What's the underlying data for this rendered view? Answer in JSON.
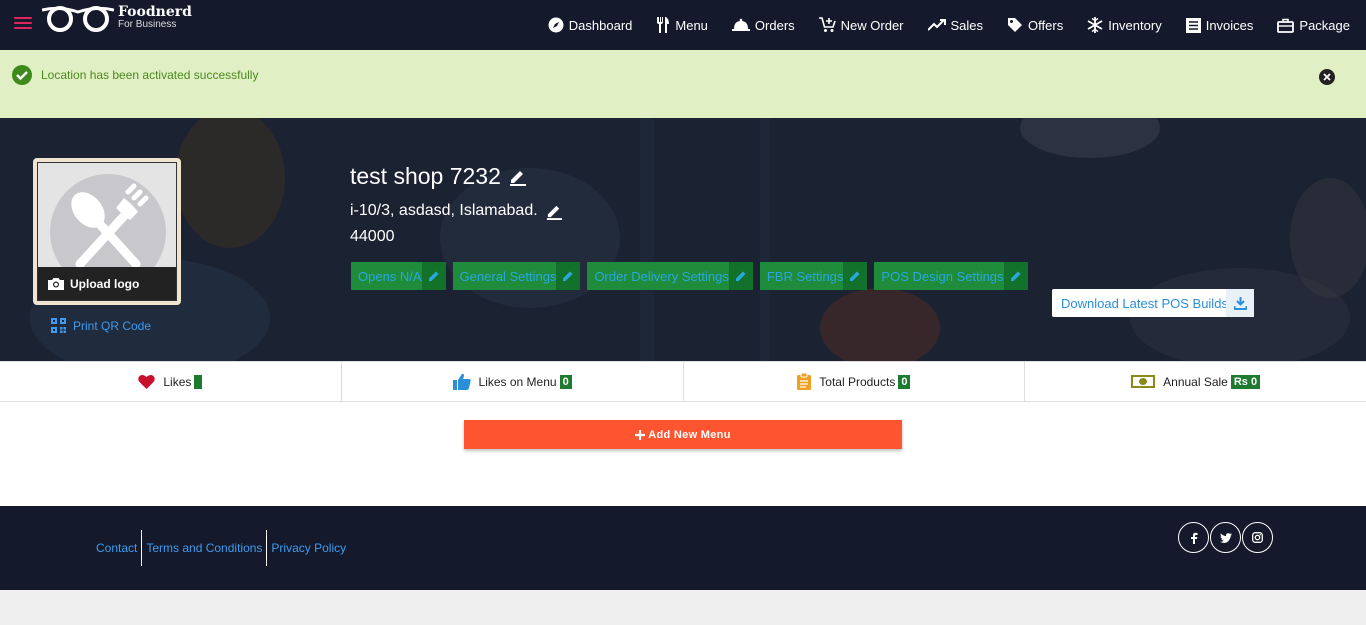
{
  "brand": {
    "name": "Foodnerd",
    "tagline": "For Business"
  },
  "nav": {
    "dashboard": "Dashboard",
    "menu": "Menu",
    "orders": "Orders",
    "new_order": "New Order",
    "sales": "Sales",
    "offers": "Offers",
    "inventory": "Inventory",
    "invoices": "Invoices",
    "package": "Package"
  },
  "alert": {
    "message": "Location has been activated successfully"
  },
  "shop": {
    "name": "test shop 7232",
    "address": "i-10/3, asdasd, Islamabad.",
    "postal_code": "44000",
    "upload_logo": "Upload logo",
    "print_qr": "Print QR Code"
  },
  "settings": {
    "opens": "Opens N/A",
    "general": "General Settings",
    "order_delivery": "Order Delivery Settings",
    "fbr": "FBR Settings",
    "pos_design": "POS Design Settings"
  },
  "pos_download": "Download Latest POS Builds",
  "stats": {
    "likes_label": "Likes",
    "likes_value": "",
    "menu_likes_label": "Likes on Menu",
    "menu_likes_value": "0",
    "products_label": "Total Products",
    "products_value": "0",
    "annual_sale_label": "Annual Sale",
    "annual_sale_value": "Rs 0"
  },
  "add_menu_label": "Add New Menu",
  "footer": {
    "contact": "Contact",
    "terms": "Terms and Conditions",
    "privacy": "Privacy Policy"
  },
  "colors": {
    "nav_bg": "#141a2b",
    "alert_bg": "#e1f0c4",
    "setting_green": "#1e8c3a",
    "accent_orange": "#fd5530",
    "link_blue": "#3d9bf0"
  }
}
